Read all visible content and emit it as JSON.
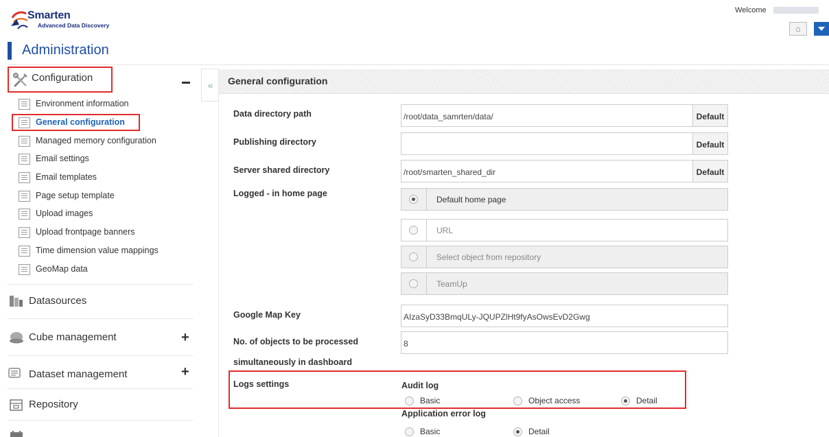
{
  "header": {
    "brand_name": "Smarten",
    "brand_tagline": "Advanced Data Discovery",
    "welcome_label": "Welcome",
    "accent_color": "#1f64b8"
  },
  "page_title": "Administration",
  "sidebar": {
    "configuration": {
      "label": "Configuration",
      "icon": "tools-icon",
      "items": [
        {
          "label": "Environment information"
        },
        {
          "label": "General configuration",
          "active": true
        },
        {
          "label": "Managed memory configuration"
        },
        {
          "label": "Email settings"
        },
        {
          "label": "Email templates"
        },
        {
          "label": "Page setup template"
        },
        {
          "label": "Upload images"
        },
        {
          "label": "Upload frontpage banners"
        },
        {
          "label": "Time dimension value mappings"
        },
        {
          "label": "GeoMap data"
        }
      ]
    },
    "sections": [
      {
        "label": "Datasources",
        "icon": "datasource-icon"
      },
      {
        "label": "Cube management",
        "icon": "cube-icon"
      },
      {
        "label": "Dataset management",
        "icon": "dataset-icon"
      },
      {
        "label": "Repository",
        "icon": "repository-icon"
      }
    ]
  },
  "main": {
    "section_title": "General configuration",
    "data_dir": {
      "label": "Data directory path",
      "value": "/root/data_samrten/data/",
      "default_label": "Default"
    },
    "publishing_dir": {
      "label": "Publishing directory",
      "value": "",
      "default_label": "Default"
    },
    "shared_dir": {
      "label": "Server shared directory",
      "value": "/root/smarten_shared_dir",
      "default_label": "Default"
    },
    "home_page": {
      "label": "Logged - in home page",
      "options": [
        {
          "label": "Default home page",
          "selected": true
        },
        {
          "label": "URL",
          "selected": false
        },
        {
          "label": "Select object from repository",
          "selected": false
        },
        {
          "label": "TeamUp",
          "selected": false
        }
      ]
    },
    "google_map_key": {
      "label": "Google Map Key",
      "value": "AIzaSyD33BmqULy-JQUPZlHt9fyAsOwsEvD2Gwg"
    },
    "objects_processed": {
      "label_line1": "No. of objects to be processed",
      "label_line2": "simultaneously in dashboard",
      "value": "8"
    },
    "logs": {
      "label": "Logs settings",
      "audit": {
        "title": "Audit log",
        "options": [
          {
            "label": "Basic",
            "selected": false
          },
          {
            "label": "Object access",
            "selected": false
          },
          {
            "label": "Detail",
            "selected": true
          }
        ]
      },
      "error": {
        "title": "Application error log",
        "options": [
          {
            "label": "Basic",
            "selected": false
          },
          {
            "label": "Detail",
            "selected": true
          }
        ]
      }
    }
  }
}
